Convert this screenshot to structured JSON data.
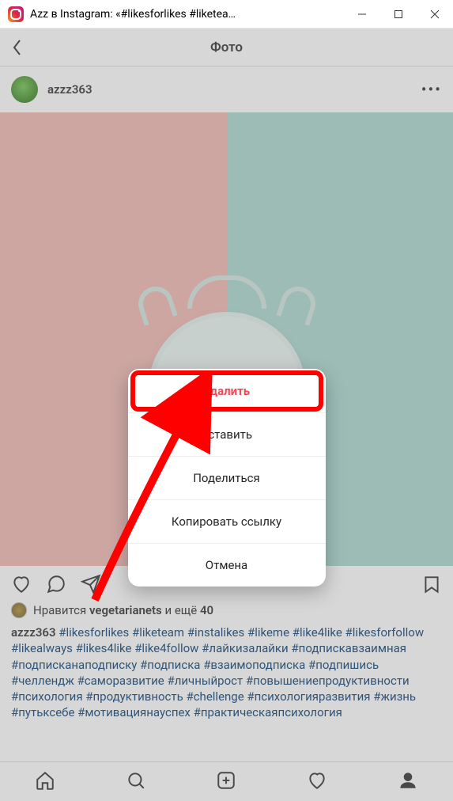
{
  "window": {
    "title": "Azz в Instagram: «#likesforlikes #liketea…"
  },
  "header": {
    "title": "Фото"
  },
  "post": {
    "username": "azzz363",
    "likes_prefix": "Нравится",
    "likes_user": "vegetarianets",
    "likes_and": "и ещё",
    "likes_count": "40",
    "caption_user": "azzz363",
    "tags": [
      "#likesforlikes",
      "#liketeam",
      "#instalikes",
      "#likeme",
      "#like4like",
      "#likesforfollow",
      "#likealways",
      "#likes4like",
      "#like4follow",
      "#лайкизалайки",
      "#подпискавзаимная",
      "#подписканаподписку",
      "#подписка",
      "#взаимоподписка",
      "#подпишись",
      "#челлендж",
      "#саморазвитие",
      "#личныйрост",
      "#повышениепродуктивности",
      "#психология",
      "#продуктивность",
      "#chellenge",
      "#психологияразвития",
      "#жизнь",
      "#путьксебе",
      "#мотивациянауспех",
      "#практическаяпсихология"
    ]
  },
  "sheet": {
    "delete": "Удалить",
    "insert": "Вставить",
    "share": "Поделиться",
    "copy_link": "Копировать ссылку",
    "cancel": "Отмена"
  }
}
